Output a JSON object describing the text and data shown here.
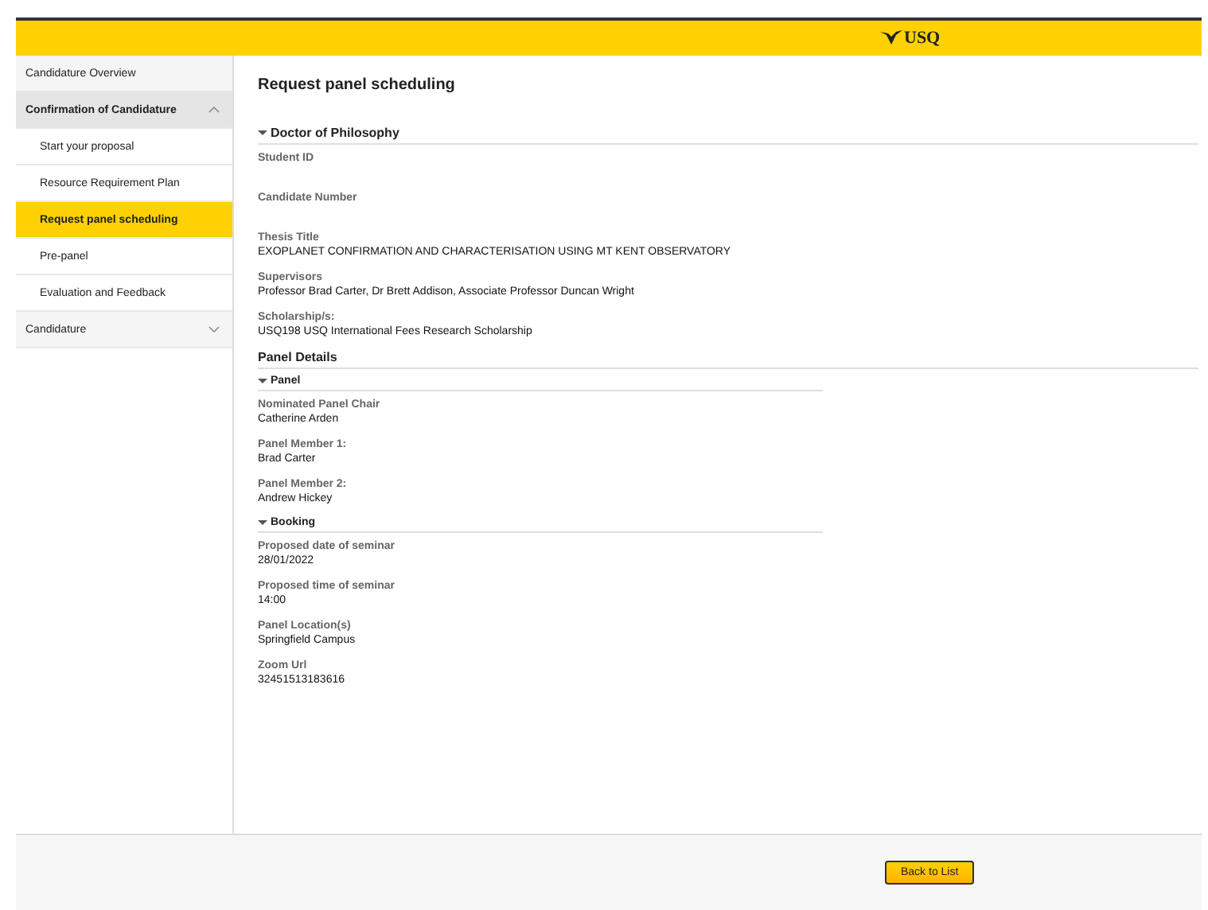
{
  "header": {
    "logo": "USQ"
  },
  "sidebar": {
    "items": [
      {
        "kind": "link",
        "label": "Candidature Overview",
        "selected": false
      },
      {
        "kind": "group",
        "label": "Confirmation of Candidature",
        "selected": false,
        "expanded": true,
        "children": [
          {
            "label": "Start your proposal",
            "selected": false
          },
          {
            "label": "Resource Requirement Plan",
            "selected": false
          },
          {
            "label": "Request panel scheduling",
            "selected": true
          },
          {
            "label": "Pre-panel",
            "selected": false
          },
          {
            "label": "Evaluation and Feedback",
            "selected": false
          }
        ]
      },
      {
        "kind": "group",
        "label": "Candidature",
        "selected": false,
        "expanded": false
      }
    ]
  },
  "main": {
    "title": "Request panel scheduling",
    "section": {
      "title": "Doctor of Philosophy",
      "expanded": true,
      "fields": [
        {
          "label": "Student ID"
        },
        {
          "label": "Candidate Number"
        },
        {
          "label": "Thesis Title",
          "value": "EXOPLANET CONFIRMATION AND CHARACTERISATION USING MT KENT OBSERVATORY"
        },
        {
          "label": "Supervisors",
          "value": "Professor Brad Carter, Dr Brett Addison, Associate Professor Duncan Wright"
        },
        {
          "label": "Scholarship/s:",
          "value": "USQ198 USQ International Fees Research Scholarship"
        }
      ]
    },
    "panel_details": {
      "title": "Panel Details",
      "subsections": [
        {
          "title": "Panel",
          "expanded": true,
          "fields": [
            {
              "label": "Nominated Panel Chair",
              "value": "Catherine Arden"
            },
            {
              "label": "Panel Member 1:",
              "value": "Brad Carter"
            },
            {
              "label": "Panel Member 2:",
              "value": "Andrew Hickey"
            }
          ]
        },
        {
          "title": "Booking",
          "expanded": true,
          "fields": [
            {
              "label": "Proposed date of seminar",
              "value": "28/01/2022"
            },
            {
              "label": "Proposed time of seminar",
              "value": "14:00"
            },
            {
              "label": "Panel Location(s)",
              "value": "Springfield Campus"
            },
            {
              "label": "Zoom Url",
              "value": "32451513183616"
            }
          ]
        }
      ]
    }
  },
  "footer": {
    "button": "Back to List"
  }
}
